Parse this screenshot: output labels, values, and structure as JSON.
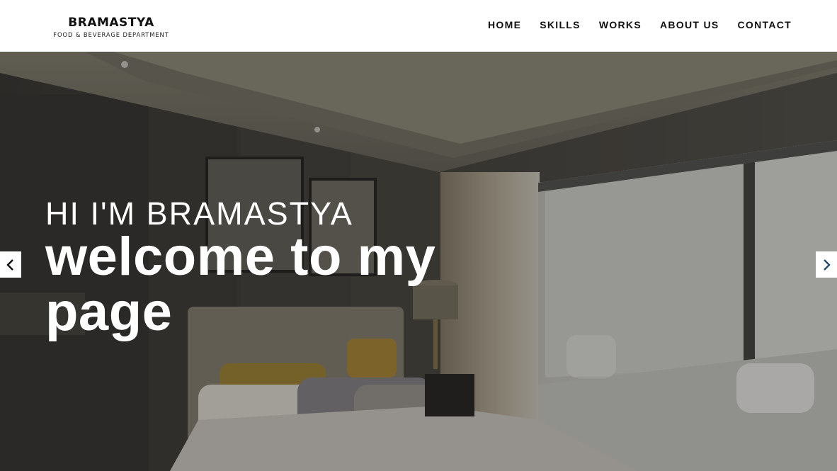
{
  "brand": {
    "name": "BRAMASTYA",
    "tagline": "FOOD & BEVERAGE DEPARTMENT"
  },
  "nav": {
    "items": [
      {
        "label": "HOME"
      },
      {
        "label": "SKILLS"
      },
      {
        "label": "WORKS"
      },
      {
        "label": "ABOUT US"
      },
      {
        "label": "CONTACT"
      }
    ]
  },
  "hero": {
    "kicker": "HI I'M BRAMASTYA",
    "title": "welcome to my page",
    "prev_icon": "chevron-left-icon",
    "next_icon": "chevron-right-icon"
  },
  "colors": {
    "header_bg": "#ffffff",
    "text_dark": "#111111",
    "hero_text": "#ffffff"
  }
}
